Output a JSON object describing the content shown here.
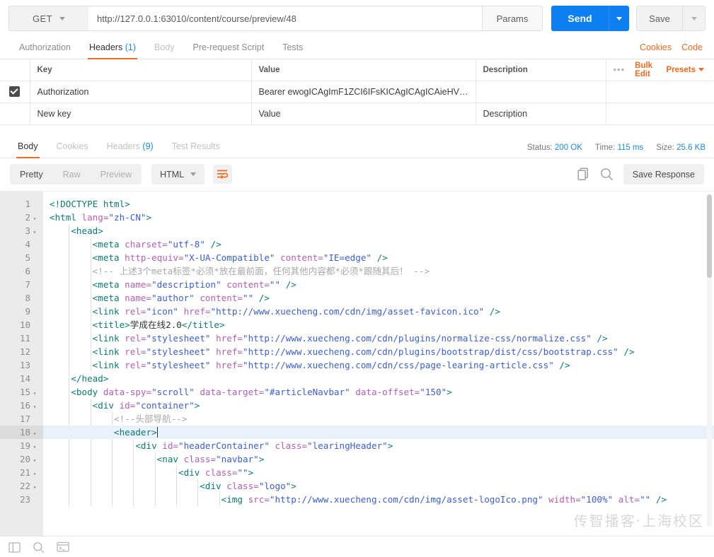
{
  "request_bar": {
    "method": "GET",
    "url": "http://127.0.0.1:63010/content/course/preview/48",
    "params_label": "Params",
    "send_label": "Send",
    "save_label": "Save"
  },
  "request_tabs": {
    "items": [
      {
        "label": "Authorization",
        "count": "",
        "state": "normal"
      },
      {
        "label": "Headers",
        "count": "(1)",
        "state": "active"
      },
      {
        "label": "Body",
        "count": "",
        "state": "dim"
      },
      {
        "label": "Pre-request Script",
        "count": "",
        "state": "normal"
      },
      {
        "label": "Tests",
        "count": "",
        "state": "normal"
      }
    ],
    "cookies_label": "Cookies",
    "code_label": "Code"
  },
  "headers_table": {
    "columns": [
      "Key",
      "Value",
      "Description"
    ],
    "actions": {
      "dots": "•••",
      "bulk_edit": "Bulk Edit",
      "presets": "Presets"
    },
    "rows": [
      {
        "checked": true,
        "key": "Authorization",
        "value": "Bearer ewogICAgImF1ZCI6IFsKICAgICAgICAieHVlY2h...",
        "description": ""
      }
    ],
    "new_row": {
      "key_placeholder": "New key",
      "value_placeholder": "Value",
      "description_placeholder": "Description"
    }
  },
  "response_tabs": {
    "items": [
      {
        "label": "Body",
        "count": "",
        "state": "active"
      },
      {
        "label": "Cookies",
        "count": "",
        "state": "normal"
      },
      {
        "label": "Headers",
        "count": "(9)",
        "state": "normal"
      },
      {
        "label": "Test Results",
        "count": "",
        "state": "normal"
      }
    ],
    "status_label": "Status:",
    "status_value": "200 OK",
    "time_label": "Time:",
    "time_value": "115 ms",
    "size_label": "Size:",
    "size_value": "25.6 KB"
  },
  "response_toolbar": {
    "view_modes": [
      {
        "label": "Pretty",
        "active": true
      },
      {
        "label": "Raw",
        "active": false
      },
      {
        "label": "Preview",
        "active": false
      }
    ],
    "language": "HTML",
    "wrap_icon": "word-wrap-icon",
    "copy_icon": "copy-icon",
    "search_icon": "search-icon",
    "save_response_label": "Save Response"
  },
  "editor": {
    "highlighted_line": 18,
    "watermark": "传智播客·上海校区",
    "lines": [
      {
        "n": 1,
        "fold": false,
        "indent": 0
      },
      {
        "n": 2,
        "fold": true,
        "indent": 0
      },
      {
        "n": 3,
        "fold": true,
        "indent": 1
      },
      {
        "n": 4,
        "fold": false,
        "indent": 2
      },
      {
        "n": 5,
        "fold": false,
        "indent": 2
      },
      {
        "n": 6,
        "fold": false,
        "indent": 2
      },
      {
        "n": 7,
        "fold": false,
        "indent": 2
      },
      {
        "n": 8,
        "fold": false,
        "indent": 2
      },
      {
        "n": 9,
        "fold": false,
        "indent": 2
      },
      {
        "n": 10,
        "fold": false,
        "indent": 2
      },
      {
        "n": 11,
        "fold": false,
        "indent": 2,
        "wrapped": 1
      },
      {
        "n": 12,
        "fold": false,
        "indent": 2,
        "wrapped": 1
      },
      {
        "n": 13,
        "fold": false,
        "indent": 2
      },
      {
        "n": 14,
        "fold": false,
        "indent": 1
      },
      {
        "n": 15,
        "fold": true,
        "indent": 1
      },
      {
        "n": 16,
        "fold": true,
        "indent": 2
      },
      {
        "n": 17,
        "fold": false,
        "indent": 3
      },
      {
        "n": 18,
        "fold": true,
        "indent": 3
      },
      {
        "n": 19,
        "fold": true,
        "indent": 4
      },
      {
        "n": 20,
        "fold": true,
        "indent": 5
      },
      {
        "n": 21,
        "fold": true,
        "indent": 6
      },
      {
        "n": 22,
        "fold": true,
        "indent": 7
      },
      {
        "n": 23,
        "fold": false,
        "indent": 8,
        "wrapped": 1
      }
    ],
    "code_text": [
      "<!DOCTYPE html>",
      "<html lang=\"zh-CN\">",
      "    <head>",
      "        <meta charset=\"utf-8\" />",
      "        <meta http-equiv=\"X-UA-Compatible\" content=\"IE=edge\" />",
      "        <!-- 上述3个meta标签*必须*放在最前面，任何其他内容都*必须*跟随其后！ -->",
      "        <meta name=\"description\" content=\"\" />",
      "        <meta name=\"author\" content=\"\" />",
      "        <link rel=\"icon\" href=\"http://www.xuecheng.com/cdn/img/asset-favicon.ico\" />",
      "        <title>学成在线2.0</title>",
      "        <link rel=\"stylesheet\" href=\"http://www.xuecheng.com/cdn/plugins/normalize-css/normalize.css\" />",
      "        <link rel=\"stylesheet\" href=\"http://www.xuecheng.com/cdn/plugins/bootstrap/dist/css/bootstrap.css\" />",
      "        <link rel=\"stylesheet\" href=\"http://www.xuecheng.com/cdn/css/page-learing-article.css\" />",
      "    </head>",
      "    <body data-spy=\"scroll\" data-target=\"#articleNavbar\" data-offset=\"150\">",
      "        <div id=\"container\">",
      "            <!--头部导航-->",
      "            <header>",
      "                <div id=\"headerContainer\" class=\"learingHeader\">",
      "                    <nav class=\"navbar\">",
      "                        <div class=\"\">",
      "                            <div class=\"logo\">",
      "                                <img src=\"http://www.xuecheng.com/cdn/img/asset-logoIco.png\" width=\"100%\" alt=\"\" />"
    ]
  },
  "statusbar": {
    "sidebar_icon": "sidebar-toggle-icon",
    "search_icon": "search-icon",
    "console_icon": "console-icon"
  },
  "colors": {
    "accent_orange": "#f26b21",
    "send_blue": "#0d7ff2",
    "link_blue": "#1e8ae0"
  }
}
